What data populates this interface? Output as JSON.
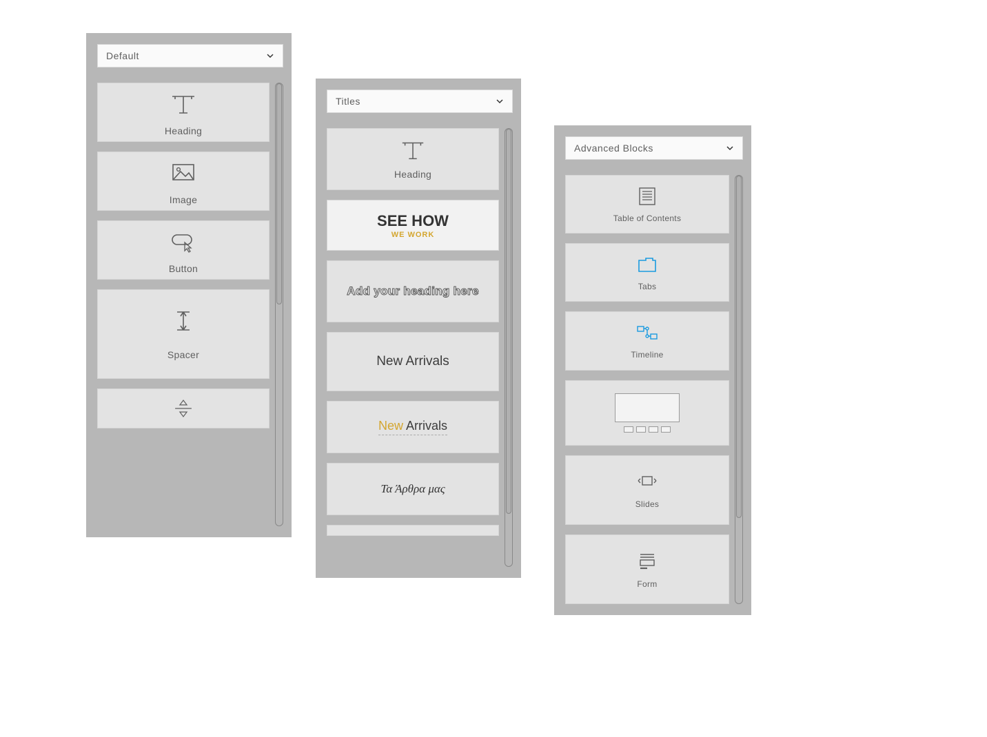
{
  "panel1": {
    "selector": "Default",
    "items": {
      "heading": "Heading",
      "image": "Image",
      "button": "Button",
      "spacer": "Spacer"
    }
  },
  "panel2": {
    "selector": "Titles",
    "heading_label": "Heading",
    "seehow": {
      "line1": "SEE HOW",
      "line2": "WE WORK"
    },
    "outline": "Add your heading here",
    "plain": "New Arrivals",
    "accent": {
      "part1": "New",
      "part2": " Arrivals"
    },
    "script": "Τα Άρθρα μας"
  },
  "panel3": {
    "selector": "Advanced Blocks",
    "items": {
      "toc": "Table of Contents",
      "tabs": "Tabs",
      "timeline": "Timeline",
      "slides": "Slides",
      "form": "Form"
    }
  }
}
